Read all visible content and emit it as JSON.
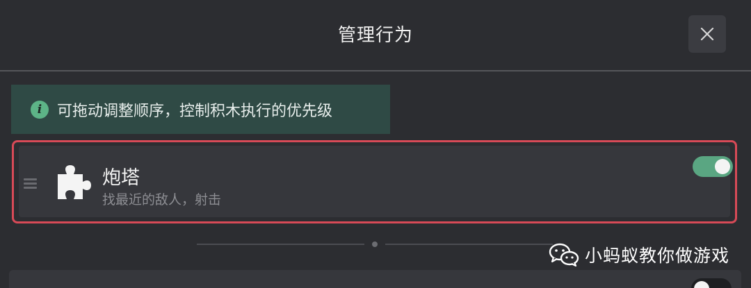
{
  "dialog": {
    "title": "管理行为",
    "close_icon": "close-icon"
  },
  "hint": {
    "icon": "info-icon",
    "text": "可拖动调整顺序，控制积木执行的优先级"
  },
  "behaviors": [
    {
      "name": "炮塔",
      "description": "找最近的敌人，射击",
      "icon": "puzzle-piece-icon",
      "enabled": true,
      "highlighted": true
    },
    {
      "enabled": false
    }
  ],
  "watermark": {
    "icon": "wechat-icon",
    "text": "小蚂蚁教你做游戏"
  },
  "colors": {
    "background": "#2c2d31",
    "card": "#36373c",
    "hint_background": "#2f4a45",
    "accent_green": "#5aa682",
    "highlight_border": "#d84a57"
  }
}
